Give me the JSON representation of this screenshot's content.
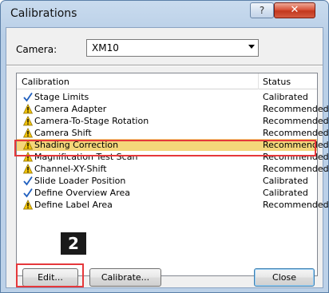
{
  "window": {
    "title": "Calibrations",
    "help_glyph": "?",
    "close_glyph": "✕"
  },
  "camera": {
    "label": "Camera:",
    "value": "XM10"
  },
  "list": {
    "columns": [
      "Calibration",
      "Status"
    ],
    "rows": [
      {
        "name": "Stage Limits",
        "status": "Calibrated",
        "icon": "checkmark-icon"
      },
      {
        "name": "Camera Adapter",
        "status": "Recommended",
        "icon": "warning-icon"
      },
      {
        "name": "Camera-To-Stage Rotation",
        "status": "Recommended",
        "icon": "warning-icon"
      },
      {
        "name": "Camera Shift",
        "status": "Recommended",
        "icon": "warning-icon"
      },
      {
        "name": "Shading Correction",
        "status": "Recommended",
        "icon": "warning-icon",
        "selected": true
      },
      {
        "name": "Magnification Test Scan",
        "status": "Recommended",
        "icon": "warning-icon"
      },
      {
        "name": "Channel-XY-Shift",
        "status": "Recommended",
        "icon": "warning-icon"
      },
      {
        "name": "Slide Loader Position",
        "status": "Calibrated",
        "icon": "checkmark-icon"
      },
      {
        "name": "Define Overview Area",
        "status": "Calibrated",
        "icon": "checkmark-icon"
      },
      {
        "name": "Define Label Area",
        "status": "Recommended",
        "icon": "warning-icon"
      }
    ]
  },
  "annotation": {
    "step_number": "2"
  },
  "buttons": {
    "edit": "Edit...",
    "calibrate": "Calibrate...",
    "close": "Close"
  },
  "colors": {
    "selection": "#f4d67a",
    "highlight": "#e5383b",
    "check": "#1f5fbf",
    "warning": "#f0c20a"
  }
}
